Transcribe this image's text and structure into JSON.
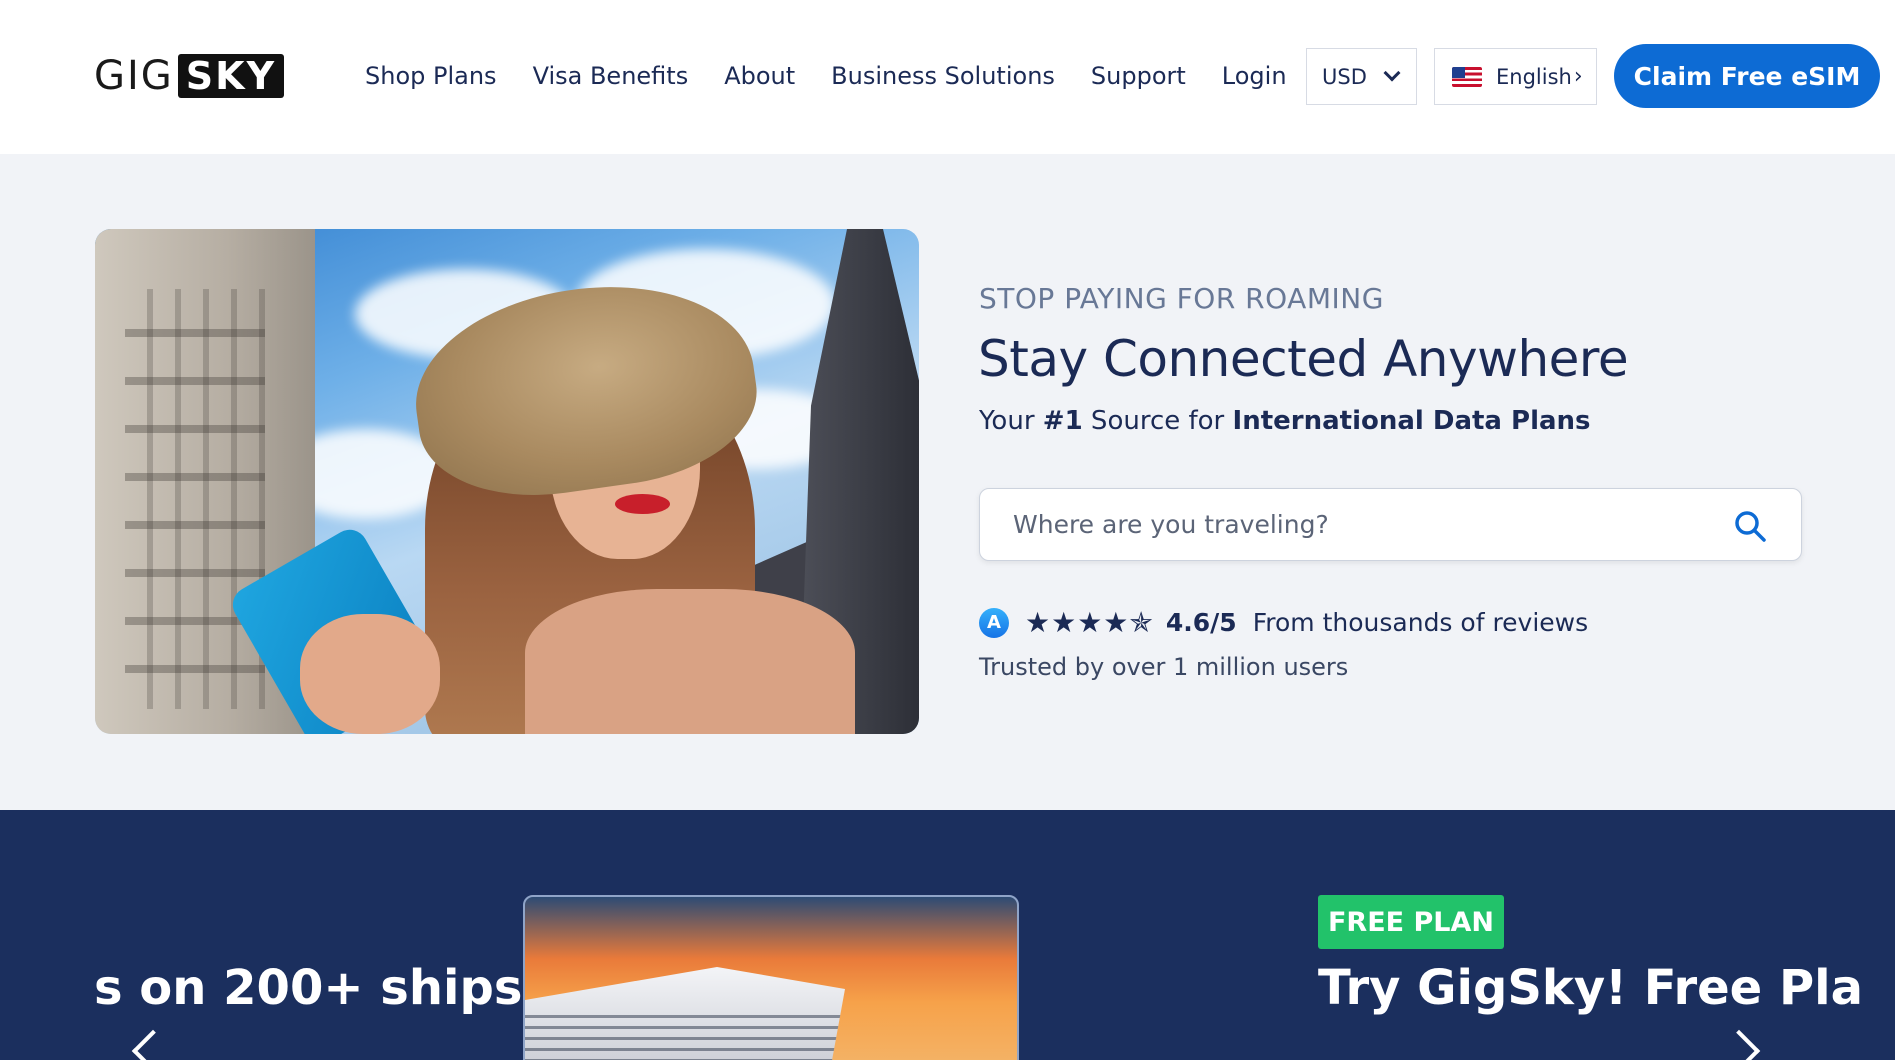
{
  "header": {
    "logo_left": "GIG",
    "logo_right": "SKY",
    "nav": {
      "shop_plans": "Shop Plans",
      "visa_benefits": "Visa Benefits",
      "about": "About",
      "business_solutions": "Business Solutions",
      "support": "Support",
      "login": "Login"
    },
    "currency": "USD",
    "language": "English",
    "cta": "Claim Free eSIM"
  },
  "hero": {
    "eyebrow": "STOP PAYING FOR ROAMING",
    "title": "Stay Connected Anywhere",
    "subtitle_prefix": "Your ",
    "subtitle_rank": "#1",
    "subtitle_mid": " Source for ",
    "subtitle_strong": "International Data Plans",
    "search_placeholder": "Where are you traveling?",
    "search_value": "",
    "rating_stars": "★★★★✯",
    "rating_value": 4.6,
    "rating_score": "4.6/5",
    "rating_text": "From thousands of reviews",
    "trusted_text": "Trusted by over 1 million users"
  },
  "promo": {
    "left_text": "s on 200+ ships",
    "badge": "FREE PLAN",
    "right_text": "Try GigSky! Free Pla"
  },
  "colors": {
    "brand_blue": "#0d6bd4",
    "navy": "#1b2a55",
    "promo_bg": "#1b2f5e",
    "badge_green": "#22c26a"
  }
}
